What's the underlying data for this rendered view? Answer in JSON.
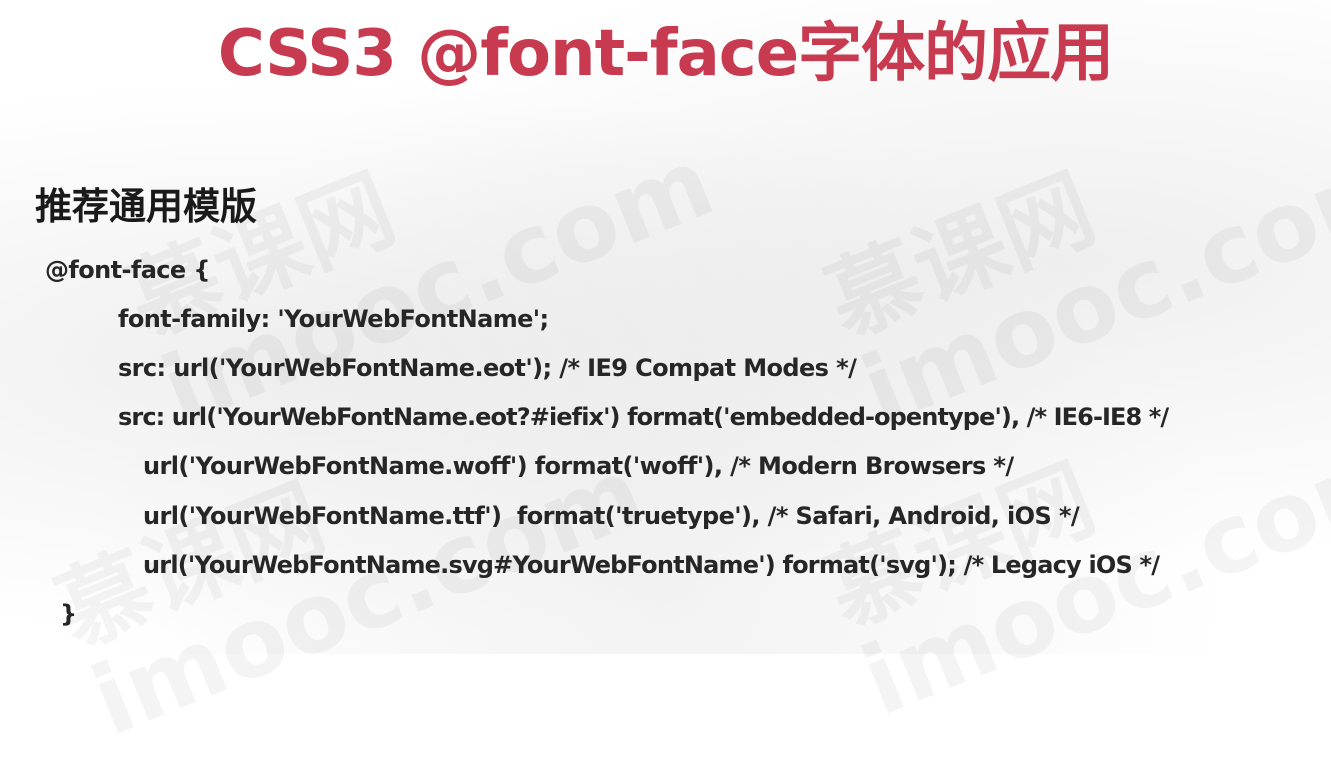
{
  "title": "CSS3 @font-face字体的应用",
  "section_heading": "推荐通用模版",
  "code_lines": [
    "@font-face {",
    "font-family: 'YourWebFontName';",
    "src: url('YourWebFontName.eot'); /* IE9 Compat Modes */",
    "src: url('YourWebFontName.eot?#iefix') format('embedded-opentype'), /* IE6-IE8 */",
    "url('YourWebFontName.woff') format('woff'), /* Modern Browsers */",
    "url('YourWebFontName.ttf')  format('truetype'), /* Safari, Android, iOS */",
    "url('YourWebFontName.svg#YourWebFontName') format('svg'); /* Legacy iOS */",
    "}"
  ],
  "watermark": {
    "cn": "慕课网",
    "en": "imooc.com"
  },
  "colors": {
    "title": "#c73a4f",
    "text": "#262626",
    "background": "#ffffff"
  }
}
